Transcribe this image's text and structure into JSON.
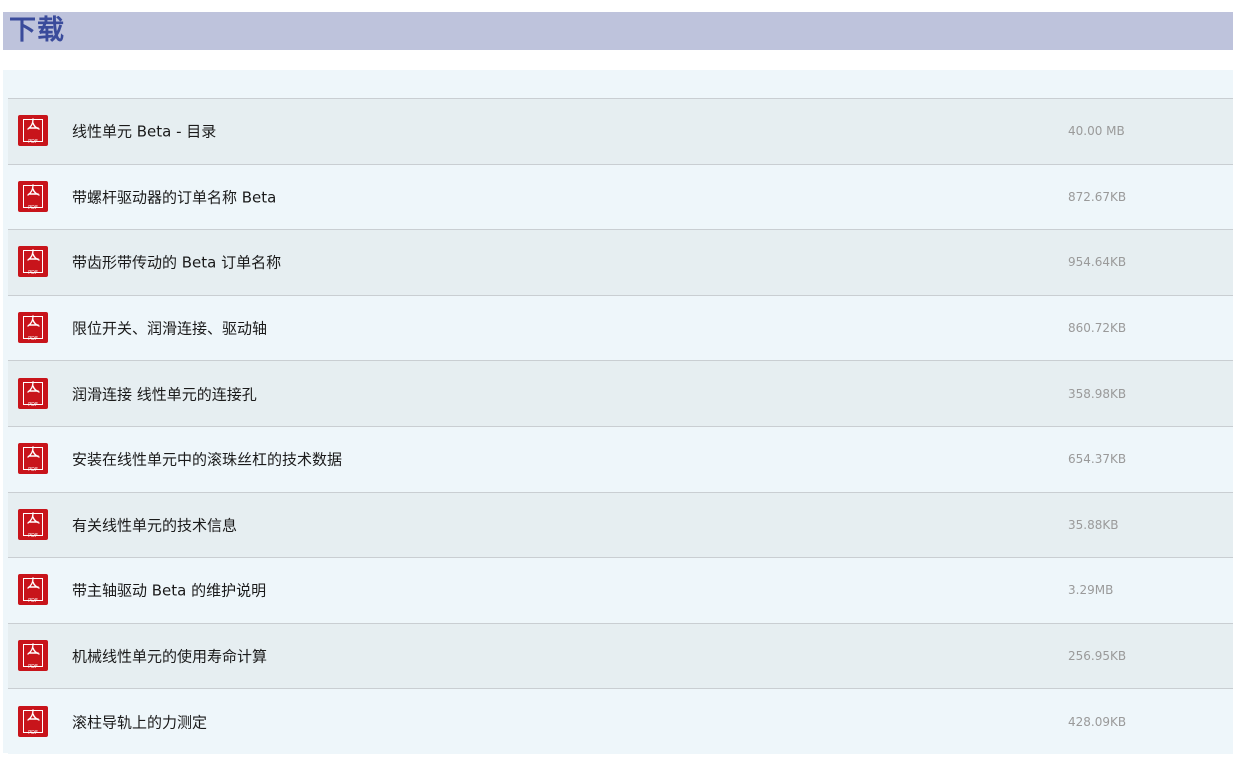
{
  "header": {
    "title": "下载"
  },
  "downloads": [
    {
      "title": "线性单元 Beta - 目录",
      "size": "40.00 MB",
      "icon": "pdf-icon"
    },
    {
      "title": "带螺杆驱动器的订单名称 Beta",
      "size": "872.67KB",
      "icon": "pdf-icon"
    },
    {
      "title": "带齿形带传动的 Beta 订单名称",
      "size": "954.64KB",
      "icon": "pdf-icon"
    },
    {
      "title": "限位开关、润滑连接、驱动轴",
      "size": "860.72KB",
      "icon": "pdf-icon"
    },
    {
      "title": "润滑连接 线性单元的连接孔",
      "size": "358.98KB",
      "icon": "pdf-icon"
    },
    {
      "title": "安装在线性单元中的滚珠丝杠的技术数据",
      "size": "654.37KB",
      "icon": "pdf-icon"
    },
    {
      "title": "有关线性单元的技术信息",
      "size": "35.88KB",
      "icon": "pdf-icon"
    },
    {
      "title": "带主轴驱动 Beta 的维护说明",
      "size": "3.29MB",
      "icon": "pdf-icon"
    },
    {
      "title": "机械线性单元的使用寿命计算",
      "size": "256.95KB",
      "icon": "pdf-icon"
    },
    {
      "title": "滚柱导轨上的力测定",
      "size": "428.09KB",
      "icon": "pdf-icon"
    }
  ],
  "pdf_icon_label": "PDF",
  "colors": {
    "header_bg": "#bec3dc",
    "header_text": "#3a4b9b",
    "row_shade": "#e6eef1",
    "row_plain": "#eef6fa",
    "pdf_red": "#c8141b"
  }
}
